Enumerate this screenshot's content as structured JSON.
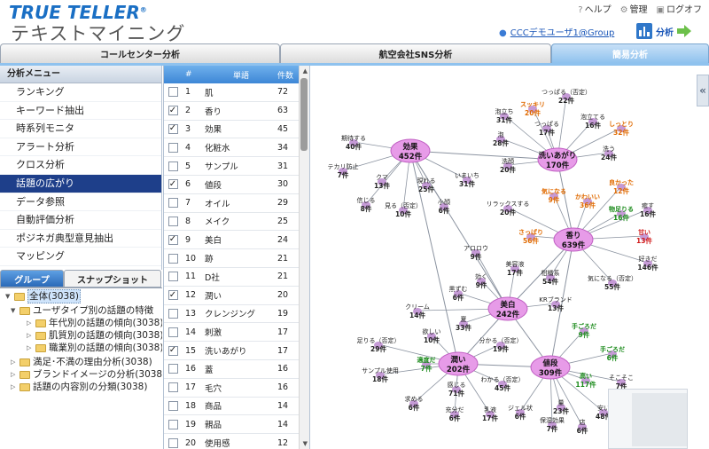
{
  "header": {
    "logo_line1": "TRUE TELLER",
    "logo_mark": "®",
    "logo_line2": "テキストマイニング",
    "help": "ヘルプ",
    "admin": "管理",
    "logout": "ログオフ",
    "user": "CCCデモユーザ1@Group",
    "analyze": "分析"
  },
  "tabs": [
    {
      "label": "コールセンター分析",
      "active": false
    },
    {
      "label": "航空会社SNS分析",
      "active": false
    },
    {
      "label": "簡易分析",
      "active": true
    }
  ],
  "menu": {
    "title": "分析メニュー",
    "items": [
      {
        "label": "ランキング",
        "selected": false
      },
      {
        "label": "キーワード抽出",
        "selected": false
      },
      {
        "label": "時系列モニタ",
        "selected": false
      },
      {
        "label": "アラート分析",
        "selected": false
      },
      {
        "label": "クロス分析",
        "selected": false
      },
      {
        "label": "話題の広がり",
        "selected": true
      },
      {
        "label": "データ参照",
        "selected": false
      },
      {
        "label": "自動評価分析",
        "selected": false
      },
      {
        "label": "ポジネガ典型意見抽出",
        "selected": false
      },
      {
        "label": "マッピング",
        "selected": false
      }
    ]
  },
  "group_tabs": {
    "group": "グループ",
    "snapshot": "スナップショット"
  },
  "tree": [
    {
      "label": "全体(3038)",
      "level": 0,
      "open": true,
      "selected": true
    },
    {
      "label": "ユーザタイプ別の話題の特徴",
      "level": 1,
      "open": true,
      "selected": false
    },
    {
      "label": "年代別の話題の傾向(3038)",
      "level": 2,
      "open": false,
      "selected": false
    },
    {
      "label": "肌質別の話題の傾向(3038)",
      "level": 2,
      "open": false,
      "selected": false
    },
    {
      "label": "職業別の話題の傾向(3038)",
      "level": 2,
      "open": false,
      "selected": false
    },
    {
      "label": "満足･不満の理由分析(3038)",
      "level": 1,
      "open": false,
      "selected": false
    },
    {
      "label": "ブランドイメージの分析(3038)",
      "level": 1,
      "open": false,
      "selected": false
    },
    {
      "label": "話題の内容別の分類(3038)",
      "level": 1,
      "open": false,
      "selected": false
    }
  ],
  "table": {
    "headers": {
      "no": "#",
      "word": "単語",
      "count": "件数"
    },
    "rows": [
      {
        "checked": false,
        "no": "1",
        "word": "肌",
        "count": "72"
      },
      {
        "checked": true,
        "no": "2",
        "word": "香り",
        "count": "63"
      },
      {
        "checked": true,
        "no": "3",
        "word": "効果",
        "count": "45"
      },
      {
        "checked": false,
        "no": "4",
        "word": "化粧水",
        "count": "34"
      },
      {
        "checked": false,
        "no": "5",
        "word": "サンプル",
        "count": "31"
      },
      {
        "checked": true,
        "no": "6",
        "word": "値段",
        "count": "30"
      },
      {
        "checked": false,
        "no": "7",
        "word": "オイル",
        "count": "29"
      },
      {
        "checked": false,
        "no": "8",
        "word": "メイク",
        "count": "25"
      },
      {
        "checked": true,
        "no": "9",
        "word": "美白",
        "count": "24"
      },
      {
        "checked": false,
        "no": "10",
        "word": "跡",
        "count": "21"
      },
      {
        "checked": false,
        "no": "11",
        "word": "D社",
        "count": "21"
      },
      {
        "checked": true,
        "no": "12",
        "word": "潤い",
        "count": "20"
      },
      {
        "checked": false,
        "no": "13",
        "word": "クレンジング",
        "count": "19"
      },
      {
        "checked": false,
        "no": "14",
        "word": "刺激",
        "count": "17"
      },
      {
        "checked": true,
        "no": "15",
        "word": "洗いあがり",
        "count": "17"
      },
      {
        "checked": false,
        "no": "16",
        "word": "蓋",
        "count": "16"
      },
      {
        "checked": false,
        "no": "17",
        "word": "毛穴",
        "count": "16"
      },
      {
        "checked": false,
        "no": "18",
        "word": "商品",
        "count": "14"
      },
      {
        "checked": false,
        "no": "19",
        "word": "親品",
        "count": "14"
      },
      {
        "checked": false,
        "no": "20",
        "word": "使用感",
        "count": "12"
      }
    ]
  },
  "graph": {
    "colors": {
      "hub": "#e79be8",
      "hub_stroke": "#c05fc3",
      "sat": "#c59ad6",
      "edge": "#8b93a0",
      "orange": "#e06a00",
      "green": "#1a8a1a",
      "red": "#d01818",
      "blue": "#1a6fc4",
      "normal": "#222222"
    },
    "hubs": [
      {
        "id": "kouka",
        "name": "効果",
        "count": "452件"
      },
      {
        "id": "araiagari",
        "name": "洗いあがり",
        "count": "170件"
      },
      {
        "id": "kaori",
        "name": "香り",
        "count": "639件"
      },
      {
        "id": "bihaku",
        "name": "美白",
        "count": "242件"
      },
      {
        "id": "uruoi",
        "name": "潤い",
        "count": "202件"
      },
      {
        "id": "nedan",
        "name": "値段",
        "count": "309件"
      }
    ],
    "sats": [
      {
        "name": "期待する",
        "count": "40件",
        "color": "normal",
        "hub": "kouka"
      },
      {
        "name": "テカリ防止",
        "count": "7件",
        "color": "normal",
        "hub": "kouka"
      },
      {
        "name": "クマ",
        "count": "13件",
        "color": "normal",
        "hub": "kouka"
      },
      {
        "name": "信じる",
        "count": "8件",
        "color": "normal",
        "hub": "kouka"
      },
      {
        "name": "見る（否定）",
        "count": "10件",
        "color": "normal",
        "hub": "kouka"
      },
      {
        "name": "現れる",
        "count": "25件",
        "color": "normal",
        "hub": "kouka"
      },
      {
        "name": "いまいち",
        "count": "31件",
        "color": "normal",
        "hub": "kouka"
      },
      {
        "name": "小顔",
        "count": "6件",
        "color": "normal",
        "hub": "kouka"
      },
      {
        "name": "スッキリ",
        "count": "20件",
        "color": "orange",
        "hub": "araiagari"
      },
      {
        "name": "つっぱる（否定）",
        "count": "22件",
        "color": "normal",
        "hub": "araiagari"
      },
      {
        "name": "泡立ち",
        "count": "31件",
        "color": "normal",
        "hub": "araiagari"
      },
      {
        "name": "つっぱる",
        "count": "17件",
        "color": "normal",
        "hub": "araiagari"
      },
      {
        "name": "泡立てる",
        "count": "16件",
        "color": "normal",
        "hub": "araiagari"
      },
      {
        "name": "しっとり",
        "count": "32件",
        "color": "orange",
        "hub": "araiagari"
      },
      {
        "name": "泡",
        "count": "28件",
        "color": "normal",
        "hub": "araiagari"
      },
      {
        "name": "洗う",
        "count": "24件",
        "color": "normal",
        "hub": "araiagari"
      },
      {
        "name": "洗顔",
        "count": "20件",
        "color": "normal",
        "hub": "araiagari"
      },
      {
        "name": "良かった",
        "count": "12件",
        "color": "orange",
        "hub": "kaori"
      },
      {
        "name": "気になる",
        "count": "9件",
        "color": "orange",
        "hub": "kaori"
      },
      {
        "name": "かわいい",
        "count": "36件",
        "color": "orange",
        "hub": "kaori"
      },
      {
        "name": "リラックスする",
        "count": "20件",
        "color": "normal",
        "hub": "kaori"
      },
      {
        "name": "物足りる",
        "count": "16件",
        "color": "green",
        "hub": "kaori"
      },
      {
        "name": "癒す",
        "count": "16件",
        "color": "normal",
        "hub": "kaori"
      },
      {
        "name": "さっぱり",
        "count": "56件",
        "color": "orange",
        "hub": "kaori"
      },
      {
        "name": "甘い",
        "count": "13件",
        "color": "red",
        "hub": "kaori"
      },
      {
        "name": "好きだ",
        "count": "146件",
        "color": "normal",
        "hub": "kaori"
      },
      {
        "name": "気になる（否定）",
        "count": "55件",
        "color": "normal",
        "hub": "kaori"
      },
      {
        "name": "柑橘系",
        "count": "54件",
        "color": "normal",
        "hub": "kaori"
      },
      {
        "name": "アロロウ",
        "count": "9件",
        "color": "normal",
        "hub": "bihaku"
      },
      {
        "name": "美容液",
        "count": "17件",
        "color": "normal",
        "hub": "bihaku"
      },
      {
        "name": "効く",
        "count": "9件",
        "color": "normal",
        "hub": "bihaku"
      },
      {
        "name": "黒ずむ",
        "count": "6件",
        "color": "normal",
        "hub": "bihaku"
      },
      {
        "name": "KRブランド",
        "count": "13件",
        "color": "normal",
        "hub": "bihaku"
      },
      {
        "name": "クリーム",
        "count": "14件",
        "color": "normal",
        "hub": "bihaku"
      },
      {
        "name": "夏",
        "count": "33件",
        "color": "normal",
        "hub": "bihaku"
      },
      {
        "name": "欲しい",
        "count": "10件",
        "color": "normal",
        "hub": "uruoi"
      },
      {
        "name": "足りる（否定）",
        "count": "29件",
        "color": "normal",
        "hub": "uruoi"
      },
      {
        "name": "分かる（否定）",
        "count": "19件",
        "color": "normal",
        "hub": "uruoi"
      },
      {
        "name": "適度だ",
        "count": "7件",
        "color": "green",
        "hub": "uruoi"
      },
      {
        "name": "サンプル使用",
        "count": "18件",
        "color": "normal",
        "hub": "uruoi"
      },
      {
        "name": "感じる",
        "count": "71件",
        "color": "normal",
        "hub": "uruoi"
      },
      {
        "name": "わかる（否定）",
        "count": "45件",
        "color": "normal",
        "hub": "uruoi"
      },
      {
        "name": "求める",
        "count": "6件",
        "color": "normal",
        "hub": "uruoi"
      },
      {
        "name": "充分だ",
        "count": "6件",
        "color": "normal",
        "hub": "uruoi"
      },
      {
        "name": "乳液",
        "count": "17件",
        "color": "normal",
        "hub": "uruoi"
      },
      {
        "name": "手ごろだ",
        "count": "9件",
        "color": "green",
        "hub": "nedan"
      },
      {
        "name": "手ごろだ",
        "count": "6件",
        "color": "green",
        "hub": "nedan"
      },
      {
        "name": "高い",
        "count": "117件",
        "color": "green",
        "hub": "nedan"
      },
      {
        "name": "そこそこ",
        "count": "7件",
        "color": "normal",
        "hub": "nedan"
      },
      {
        "name": "量",
        "count": "23件",
        "color": "normal",
        "hub": "nedan"
      },
      {
        "name": "ジェル状",
        "count": "6件",
        "color": "normal",
        "hub": "nedan"
      },
      {
        "name": "保湿効果",
        "count": "7件",
        "color": "normal",
        "hub": "nedan"
      },
      {
        "name": "店",
        "count": "6件",
        "color": "normal",
        "hub": "nedan"
      },
      {
        "name": "安い",
        "count": "48件",
        "color": "normal",
        "hub": "nedan"
      }
    ]
  }
}
